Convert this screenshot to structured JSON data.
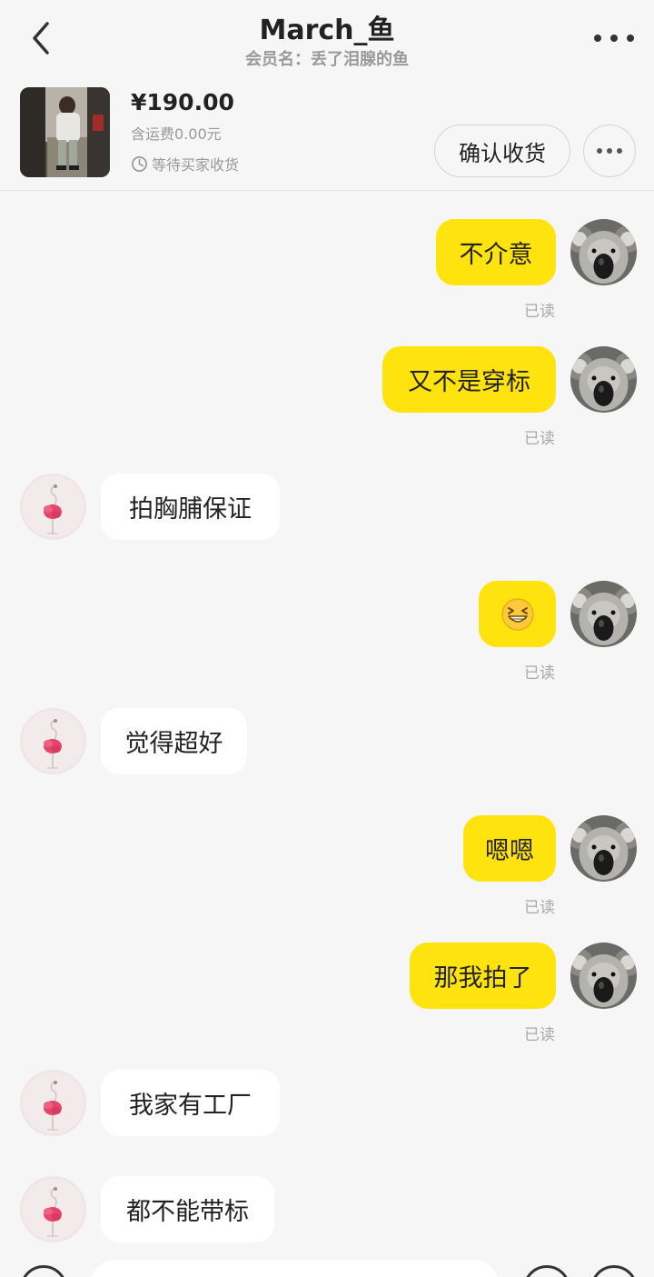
{
  "header": {
    "title": "March_鱼",
    "subtitle": "会员名：丢了泪腺的鱼",
    "back_icon": "chevron-left-icon",
    "more_icon": "more-horizontal-icon"
  },
  "order": {
    "price": "¥190.00",
    "shipping": "含运费0.00元",
    "status": "等待买家收货",
    "confirm_label": "确认收货"
  },
  "colors": {
    "my_bubble": "#ffe30e",
    "their_bubble": "#ffffff",
    "background": "#f6f6f6"
  },
  "messages": [
    {
      "sender": "me",
      "text": "不介意",
      "read": "已读"
    },
    {
      "sender": "me",
      "text": "又不是穿标",
      "read": "已读"
    },
    {
      "sender": "them",
      "text": "拍胸脯保证"
    },
    {
      "sender": "me",
      "emoji": "grinning-squint-emoji",
      "read": "已读"
    },
    {
      "sender": "them",
      "text": "觉得超好"
    },
    {
      "sender": "me",
      "text": "嗯嗯",
      "read": "已读"
    },
    {
      "sender": "me",
      "text": "那我拍了",
      "read": "已读"
    },
    {
      "sender": "them",
      "text": "我家有工厂"
    },
    {
      "sender": "them",
      "text": "都不能带标"
    }
  ],
  "input_bar": {
    "voice_icon": "voice-icon",
    "emoji_icon": "emoji-icon",
    "plus_icon": "plus-icon"
  }
}
